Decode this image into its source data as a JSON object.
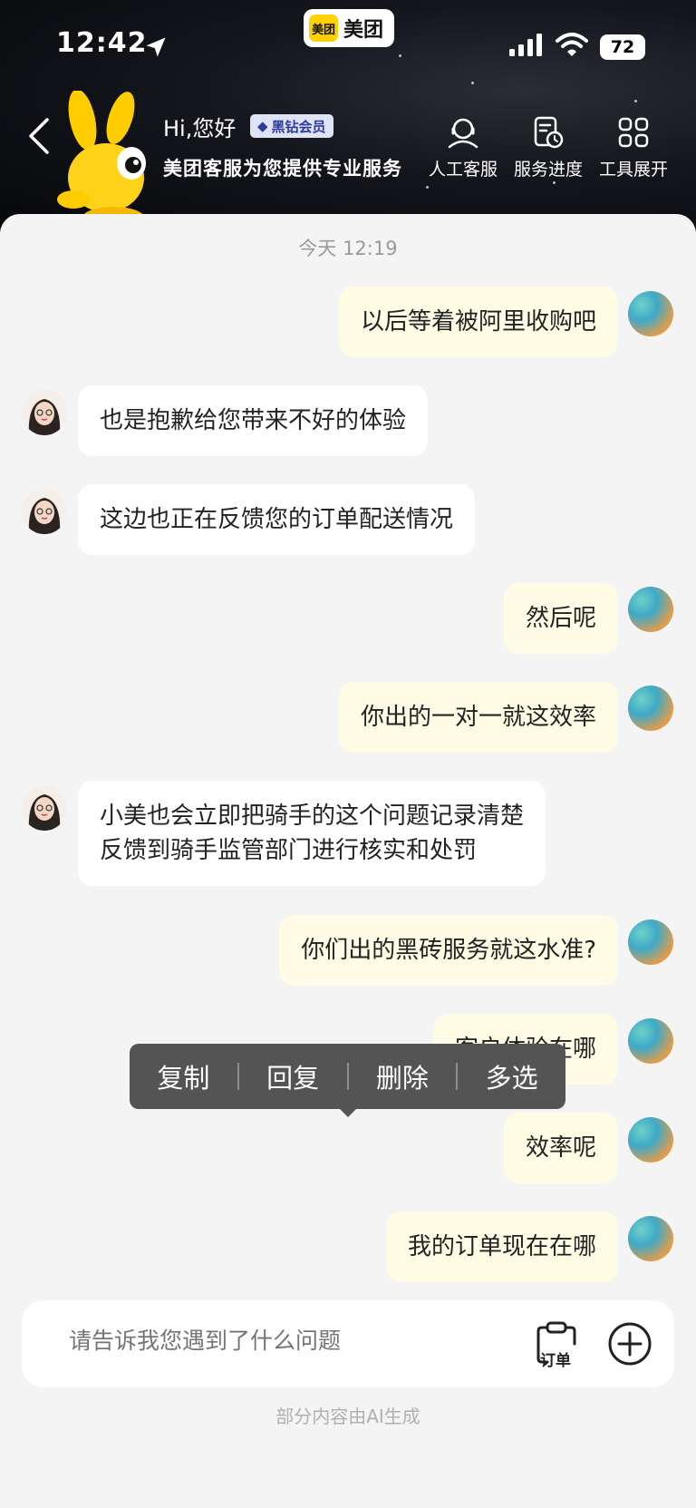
{
  "status_bar": {
    "time": "12:42",
    "battery": "72"
  },
  "app_switcher": {
    "logo_text": "美团",
    "app_name": "美团"
  },
  "header": {
    "greeting": "Hi,您好",
    "vip_badge": "黑钻会员",
    "subtitle": "美团客服为您提供专业服务",
    "tools": [
      {
        "label": "人工客服",
        "icon": "headset-icon"
      },
      {
        "label": "服务进度",
        "icon": "progress-icon"
      },
      {
        "label": "工具展开",
        "icon": "grid-icon"
      }
    ]
  },
  "chat": {
    "date": "今天 12:19",
    "messages": [
      {
        "from": "user",
        "text": "以后等着被阿里收购吧"
      },
      {
        "from": "agent",
        "text": "也是抱歉给您带来不好的体验"
      },
      {
        "from": "agent",
        "text": "这边也正在反馈您的订单配送情况"
      },
      {
        "from": "user",
        "text": "然后呢"
      },
      {
        "from": "user",
        "text": "你出的一对一就这效率"
      },
      {
        "from": "agent",
        "lines": [
          "小美也会立即把骑手的这个问题记录清楚",
          "反馈到骑手监管部门进行核实和处罚"
        ]
      },
      {
        "from": "user",
        "text": "你们出的黑砖服务就这水准?"
      },
      {
        "from": "user",
        "text": "客户体验在哪"
      },
      {
        "from": "user",
        "text": "效率呢"
      },
      {
        "from": "user",
        "text": "我的订单现在在哪"
      }
    ]
  },
  "context_menu": {
    "items": [
      "复制",
      "回复",
      "删除",
      "多选"
    ]
  },
  "input": {
    "placeholder": "请告诉我您遇到了什么问题",
    "order_label": "订单"
  },
  "footnote": "部分内容由AI生成"
}
